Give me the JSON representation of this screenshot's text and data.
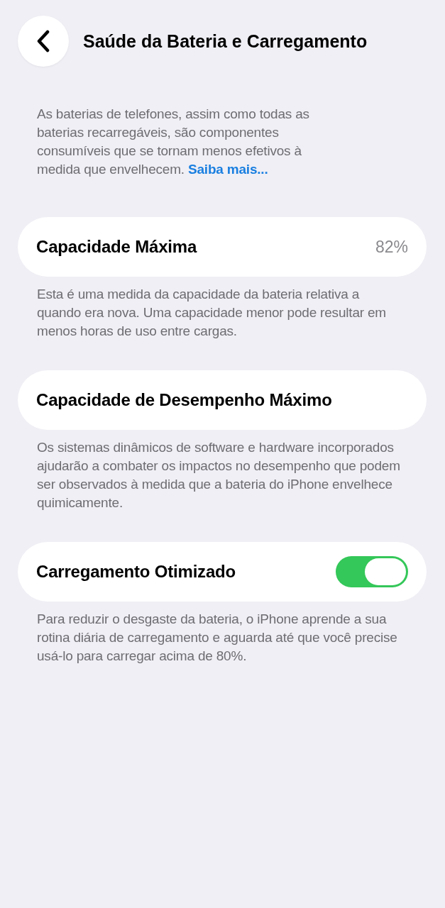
{
  "header": {
    "title": "Saúde da Bateria e Carregamento"
  },
  "intro": {
    "text": "As baterias de telefones, assim como todas as baterias recarregáveis, são componentes consumíveis que se tornam menos efetivos à medida que envelhecem.",
    "link": "Saiba mais..."
  },
  "sections": [
    {
      "kind": "value",
      "title": "Capacidade Máxima",
      "value": "82%",
      "footer": "Esta é uma medida da capacidade da bateria relativa a quando era nova. Uma capacidade menor pode resultar em menos horas de uso entre cargas."
    },
    {
      "kind": "plain",
      "title": "Capacidade de Desempenho Máximo",
      "footer": "Os sistemas dinâmicos de software e hardware incorporados ajudarão a combater os impactos no desempenho que podem ser observados à medida que a bateria do iPhone envelhece quimicamente."
    },
    {
      "kind": "toggle",
      "title": "Carregamento Otimizado",
      "on": true,
      "footer": "Para reduzir o desgaste da bateria, o iPhone aprende a sua rotina diária de carregamento e aguarda até que você precise usá-lo para carregar acima de 80%."
    }
  ]
}
